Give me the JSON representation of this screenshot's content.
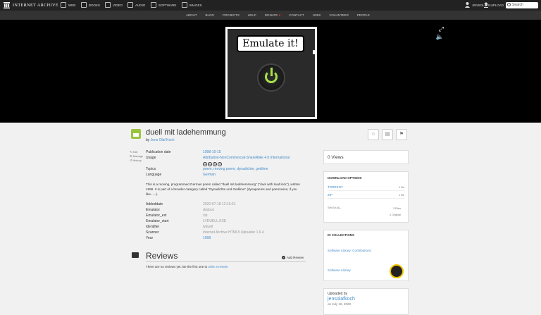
{
  "topbar": {
    "logo_text": "INTERNET ARCHIVE",
    "media": [
      {
        "label": "WEB",
        "icon": "web-icon"
      },
      {
        "label": "BOOKS",
        "icon": "book-icon"
      },
      {
        "label": "VIDEO",
        "icon": "film-icon"
      },
      {
        "label": "AUDIO",
        "icon": "speaker-icon"
      },
      {
        "label": "SOFTWARE",
        "icon": "floppy-icon"
      },
      {
        "label": "IMAGES",
        "icon": "image-icon"
      }
    ],
    "account": "JENSOLAFK...",
    "upload": "UPLOAD",
    "search_placeholder": "Search"
  },
  "nav": [
    "ABOUT",
    "BLOG",
    "PROJECTS",
    "HELP",
    "DONATE",
    "CONTACT",
    "JOBS",
    "VOLUNTEER",
    "PEOPLE"
  ],
  "nav_heart": "♥",
  "theater": {
    "label": "Emulate it!",
    "fullscreen_icon": "⤢",
    "mute_icon": "🔈"
  },
  "item": {
    "title": "duell mit ladehemmung",
    "by_prefix": "by",
    "author": "Jens Olaf Koch",
    "side_actions": [
      "Edit",
      "Manage",
      "History"
    ]
  },
  "metadata": [
    {
      "label": "Publication date",
      "value": "1998-10-15",
      "link": true
    },
    {
      "label": "Usage",
      "value": "Attribution-NonCommercial-ShareAlike 4.0 International",
      "link": true
    },
    {
      "label": "Topics",
      "value": "poem, moving poem, dynadichte, gedilme",
      "link": true
    },
    {
      "label": "Language",
      "value": "German",
      "link": true
    }
  ],
  "cc_icons": [
    "cc",
    "by",
    "nc",
    "sa"
  ],
  "description": "This is a moving, programmed German poem called \"duell mit ladehemmung\" (\"duel with load lock\"), written 1998. It is part of a broader category called \"Dynadichte und Gedilme\" (dynapoems and poemovies, if you like......).",
  "metadata2": [
    {
      "label": "Addeddate",
      "value": "2020-07-18 12:16:31"
    },
    {
      "label": "Emulator",
      "value": "dosbox"
    },
    {
      "label": "Emulator_ext",
      "value": "zip"
    },
    {
      "label": "Emulator_start",
      "value": "LYDUELL.EXE"
    },
    {
      "label": "Identifier",
      "value": "lyduell"
    },
    {
      "label": "Scanner",
      "value": "Internet Archive HTML5 Uploader 1.6.4"
    },
    {
      "label": "Year",
      "value": "1998",
      "link": true
    }
  ],
  "reviews": {
    "title": "Reviews",
    "add": "Add Review",
    "empty_prefix": "There are no reviews yet. Be the first one to",
    "empty_link": "write a review."
  },
  "sidebar": {
    "views": "0 Views",
    "download_title": "DOWNLOAD OPTIONS",
    "downloads": [
      {
        "label": "TORRENT",
        "count": "1 file"
      },
      {
        "label": "ZIP",
        "count": "1 file"
      }
    ],
    "show_all": "SHOW ALL",
    "total_files": "3 Files",
    "original": "3 Original",
    "collections_title": "IN COLLECTIONS",
    "collections": [
      "Software Library: Contributions",
      "Software Library"
    ],
    "uploaded_by": "Uploaded by",
    "uploader": "jensolafkoch",
    "uploaded_date": "on July 18, 2020"
  },
  "colors": {
    "accent": "#428bca",
    "software_green": "#9bc43f"
  }
}
